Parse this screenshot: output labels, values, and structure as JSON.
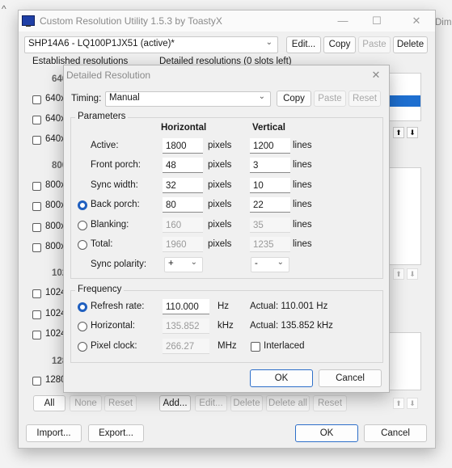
{
  "bg": {
    "caret": "^",
    "partial_text": "Dim"
  },
  "main": {
    "title": "Custom Resolution Utility 1.5.3 by ToastyX",
    "controls": {
      "minimize": "—",
      "maximize": "☐",
      "close": "✕"
    },
    "monitor": {
      "value": "SHP14A6 - LQ100P1JX51 (active)*",
      "chevron": "⌄"
    },
    "top_buttons": {
      "edit": "Edit...",
      "copy": "Copy",
      "paste": "Paste",
      "delete": "Delete"
    },
    "established_label": "Established resolutions",
    "detailed_label": "Detailed resolutions (0 slots left)",
    "established_partial": {
      "h640": "640",
      "r640_1": "640x",
      "r640_2": "640x",
      "r640_3": "640x",
      "h800": "800",
      "r800_1": "800x",
      "r800_2": "800x",
      "r800_3": "800x",
      "r800_4": "800x",
      "h102": "102",
      "r1024_1": "1024",
      "r1024_2": "1024",
      "r1024_3": "1024",
      "h128": "128",
      "r1280": "1280"
    },
    "est_buttons": {
      "all": "All",
      "none": "None",
      "reset": "Reset"
    },
    "detail_buttons": {
      "add": "Add...",
      "edit": "Edit...",
      "delete": "Delete",
      "delete_all": "Delete all",
      "reset": "Reset"
    },
    "arrows": {
      "up": "⬆",
      "down": "⬇"
    },
    "bottom": {
      "import": "Import...",
      "export": "Export...",
      "ok": "OK",
      "cancel": "Cancel"
    }
  },
  "dialog": {
    "title": "Detailed Resolution",
    "close": "✕",
    "timing_label": "Timing:",
    "timing_value": "Manual",
    "timing_buttons": {
      "copy": "Copy",
      "paste": "Paste",
      "reset": "Reset"
    },
    "params_label": "Parameters",
    "col_h": "Horizontal",
    "col_v": "Vertical",
    "rows": [
      {
        "label": "Active:",
        "h": "1800",
        "hu": "pixels",
        "v": "1200",
        "vu": "lines"
      },
      {
        "label": "Front porch:",
        "h": "48",
        "hu": "pixels",
        "v": "3",
        "vu": "lines"
      },
      {
        "label": "Sync width:",
        "h": "32",
        "hu": "pixels",
        "v": "10",
        "vu": "lines"
      },
      {
        "label": "Back porch:",
        "h": "80",
        "hu": "pixels",
        "v": "22",
        "vu": "lines"
      },
      {
        "label": "Blanking:",
        "h": "160",
        "hu": "pixels",
        "v": "35",
        "vu": "lines"
      },
      {
        "label": "Total:",
        "h": "1960",
        "hu": "pixels",
        "v": "1235",
        "vu": "lines"
      }
    ],
    "sync_label": "Sync polarity:",
    "sync_h": "+",
    "sync_v": "-",
    "freq_label": "Frequency",
    "refresh_label": "Refresh rate:",
    "refresh_value": "110.000",
    "refresh_unit": "Hz",
    "refresh_actual": "Actual: 110.001 Hz",
    "hfreq_label": "Horizontal:",
    "hfreq_value": "135.852",
    "hfreq_unit": "kHz",
    "hfreq_actual": "Actual: 135.852 kHz",
    "pclk_label": "Pixel clock:",
    "pclk_value": "266.27",
    "pclk_unit": "MHz",
    "interlaced_label": "Interlaced",
    "ok": "OK",
    "cancel": "Cancel"
  },
  "colors": {
    "accent": "#1f5fbf",
    "selection": "#1e6fd0"
  }
}
